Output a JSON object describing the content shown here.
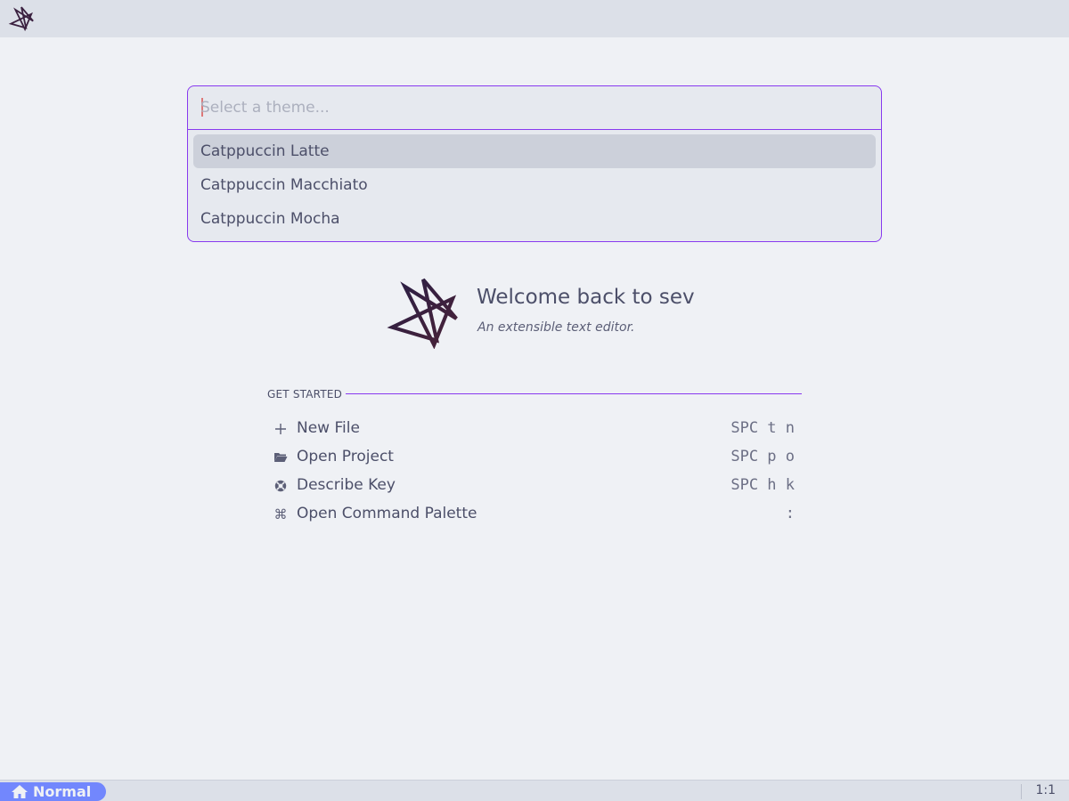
{
  "theme_picker": {
    "placeholder": "Select a theme...",
    "items": [
      {
        "label": "Catppuccin Latte",
        "selected": true
      },
      {
        "label": "Catppuccin Macchiato",
        "selected": false
      },
      {
        "label": "Catppuccin Mocha",
        "selected": false
      }
    ]
  },
  "welcome": {
    "title": "Welcome back to sev",
    "subtitle": "An extensible text editor."
  },
  "get_started": {
    "heading": "GET STARTED",
    "actions": [
      {
        "icon": "plus-icon",
        "label": "New File",
        "shortcut": "SPC t n"
      },
      {
        "icon": "folder-open-icon",
        "label": "Open Project",
        "shortcut": "SPC p o"
      },
      {
        "icon": "lifebuoy-icon",
        "label": "Describe Key",
        "shortcut": "SPC h k"
      },
      {
        "icon": "command-icon",
        "label": "Open Command Palette",
        "shortcut": ":"
      }
    ]
  },
  "statusbar": {
    "mode": "Normal",
    "mode_icon": "home-icon",
    "position": "1:1"
  },
  "colors": {
    "accent": "#8839ef",
    "mode": "#7287fd",
    "caret": "#dd7878",
    "background": "#eff1f5",
    "logo": "#3b2140"
  }
}
